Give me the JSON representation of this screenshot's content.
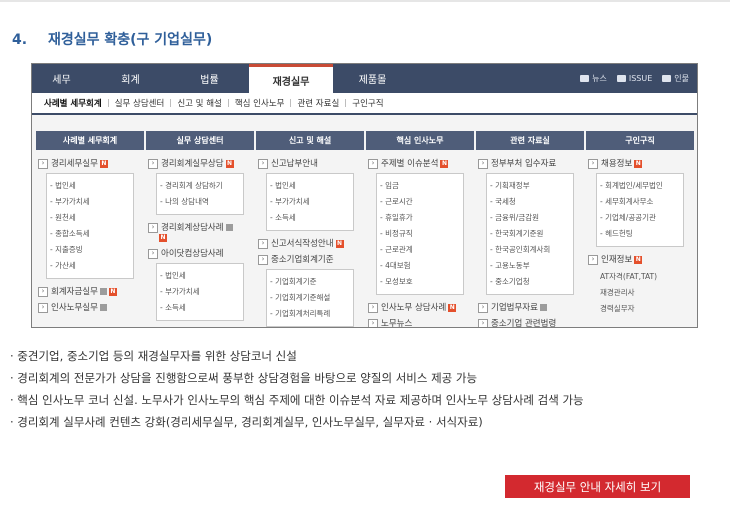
{
  "section": {
    "number": "4.",
    "title": "재경실무 확충(구 기업실무)"
  },
  "nav": {
    "tabs": [
      {
        "label": "세무"
      },
      {
        "label": "회계"
      },
      {
        "label": "법률"
      },
      {
        "label": "재경실무"
      },
      {
        "label": "제품몰"
      }
    ],
    "utils": {
      "news": "뉴스",
      "issue": "ISSUE",
      "login": "인물"
    }
  },
  "subnav": [
    "사례별 세무회계",
    "실무 상담센터",
    "신고 및 해설",
    "핵심 인사노무",
    "관련 자료실",
    "구인구직"
  ],
  "columns": [
    {
      "header": "사례별 세무회계",
      "cats": [
        {
          "label": "경리세무실무",
          "items": [
            "- 법인세",
            "- 부가가치세",
            "- 원천세",
            "- 종합소득세",
            "- 지출증빙",
            "- 가산세"
          ]
        },
        {
          "label": "회계자금실무"
        },
        {
          "label": "인사노무실무"
        }
      ]
    },
    {
      "header": "실무 상담센터",
      "cats": [
        {
          "label": "경리회계실무상담",
          "items": [
            "- 경리회계 상담하기",
            "- 나의 상담내역"
          ]
        },
        {
          "label": "경리회계상담사례"
        },
        {
          "label": "아이닷컴상담사례",
          "items": [
            "- 법인세",
            "- 부가가치세",
            "- 소득세"
          ]
        }
      ]
    },
    {
      "header": "신고 및 해설",
      "cats": [
        {
          "label": "신고납부안내",
          "items": [
            "- 법인세",
            "- 부가가치세",
            "- 소득세"
          ]
        },
        {
          "label": "신고서식작성안내"
        },
        {
          "label": "중소기업회계기준",
          "items": [
            "- 기업회계기준",
            "- 기업회계기준해설",
            "- 기업회계처리특례"
          ]
        }
      ]
    },
    {
      "header": "핵심 인사노무",
      "cats": [
        {
          "label": "주제별 이슈분석",
          "items": [
            "- 임금",
            "- 근로시간",
            "- 휴일휴가",
            "- 비정규직",
            "- 근로관계",
            "- 4대보험",
            "- 모성보호"
          ]
        },
        {
          "label": "인사노무 상담사례"
        },
        {
          "label": "노무뉴스"
        }
      ]
    },
    {
      "header": "관련 자료실",
      "cats": [
        {
          "label": "정부부처 입수자료",
          "items": [
            "- 기획재정부",
            "- 국세청",
            "- 금융위/금감원",
            "- 한국회계기준원",
            "- 한국공인회계사회",
            "- 고용노동부",
            "- 중소기업청"
          ]
        },
        {
          "label": "기업법무자료"
        },
        {
          "label": "중소기업 관련법령"
        }
      ]
    },
    {
      "header": "구인구직",
      "cats": [
        {
          "label": "채용정보",
          "items": [
            "- 회계법인/세무법인",
            "- 세무회계사무소",
            "- 기업체/공공기관",
            "- 헤드헌팅"
          ]
        },
        {
          "label": "인재정보",
          "plain": [
            "AT자격(FAT,TAT)",
            "재경관리사",
            "경력실무자"
          ]
        }
      ]
    }
  ],
  "bullets": [
    "· 중견기업, 중소기업 등의 재경실무자를 위한 상담코너 신설",
    "· 경리회계의 전문가가 상담을 진행함으로써 풍부한 상담경험을 바탕으로 양질의 서비스 제공 가능",
    "· 핵심 인사노무 코너 신설. 노무사가 인사노무의 핵심 주제에 대한 이슈분석 자료 제공하며 인사노무 상담사례 검색 가능",
    "· 경리회계 실무사례 컨텐츠 강화(경리세무실무, 경리회계실무, 인사노무실무, 실무자료 · 서식자료)"
  ],
  "cta": {
    "label": "재경실무 안내 자세히 보기"
  },
  "colors": {
    "accent": "#d3292f",
    "nav_bg": "#3c4b67",
    "title": "#2f5f9a"
  }
}
